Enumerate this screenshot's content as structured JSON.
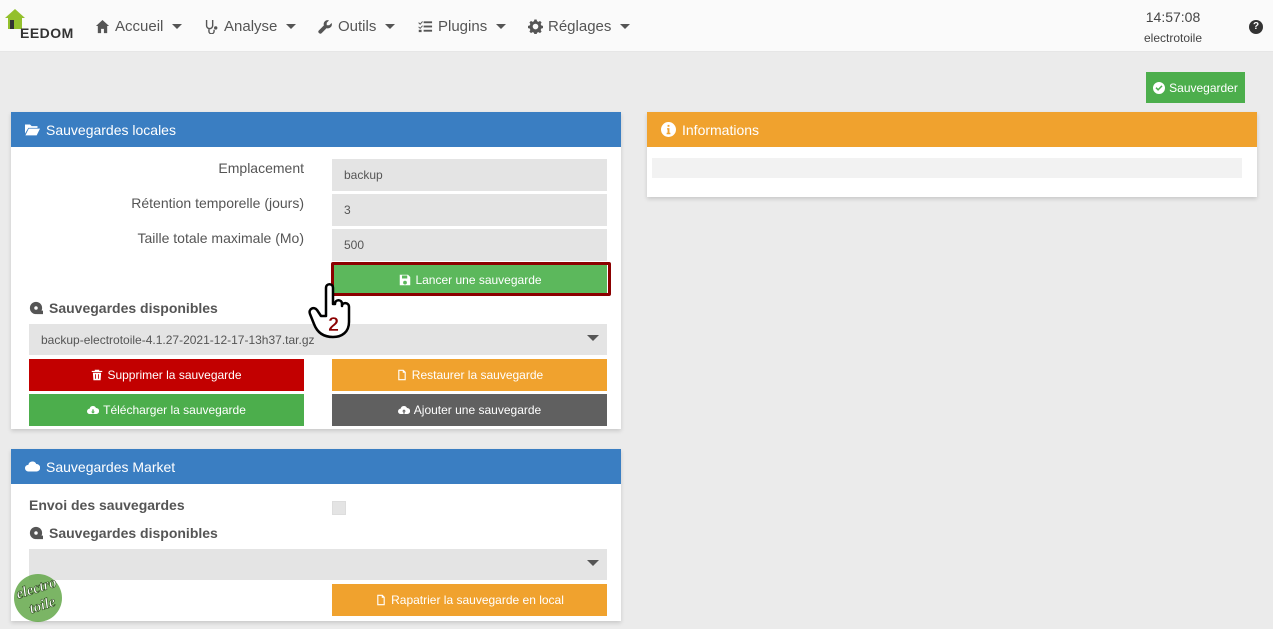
{
  "navbar": {
    "brand": "EEDOM",
    "menu": [
      {
        "label": "Accueil",
        "icon": "home-icon"
      },
      {
        "label": "Analyse",
        "icon": "stethoscope-icon"
      },
      {
        "label": "Outils",
        "icon": "wrench-icon"
      },
      {
        "label": "Plugins",
        "icon": "tasks-icon"
      },
      {
        "label": "Réglages",
        "icon": "cog-icon"
      }
    ],
    "time": "14:57:08",
    "host": "electrotoile"
  },
  "actions": {
    "save_label": "Sauvegarder"
  },
  "local_backups": {
    "title": "Sauvegardes locales",
    "fields": [
      {
        "label": "Emplacement",
        "value": "backup"
      },
      {
        "label": "Rétention temporelle (jours)",
        "value": "3"
      },
      {
        "label": "Taille totale maximale (Mo)",
        "value": "500"
      }
    ],
    "launch_label": "Lancer une sauvegarde",
    "available_label": "Sauvegardes disponibles",
    "selected_backup": "backup-electrotoile-4.1.27-2021-12-17-13h37.tar.gz",
    "delete_label": "Supprimer la sauvegarde",
    "restore_label": "Restaurer la sauvegarde",
    "download_label": "Télécharger la sauvegarde",
    "add_label": "Ajouter une sauvegarde"
  },
  "market_backups": {
    "title": "Sauvegardes Market",
    "send_label": "Envoi des sauvegardes",
    "available_label": "Sauvegardes disponibles",
    "selected_backup": "",
    "repatriate_label": "Rapatrier la sauvegarde en local"
  },
  "informations": {
    "title": "Informations"
  },
  "annotation": {
    "step": "2"
  },
  "watermark": {
    "line1": "electro",
    "line2": "toile"
  },
  "colors": {
    "blue_header": "#3a7ec2",
    "orange_header": "#f0a22e",
    "green": "#4cae4c",
    "red": "#c20000",
    "dark": "#606060",
    "highlight": "#8b0000"
  }
}
